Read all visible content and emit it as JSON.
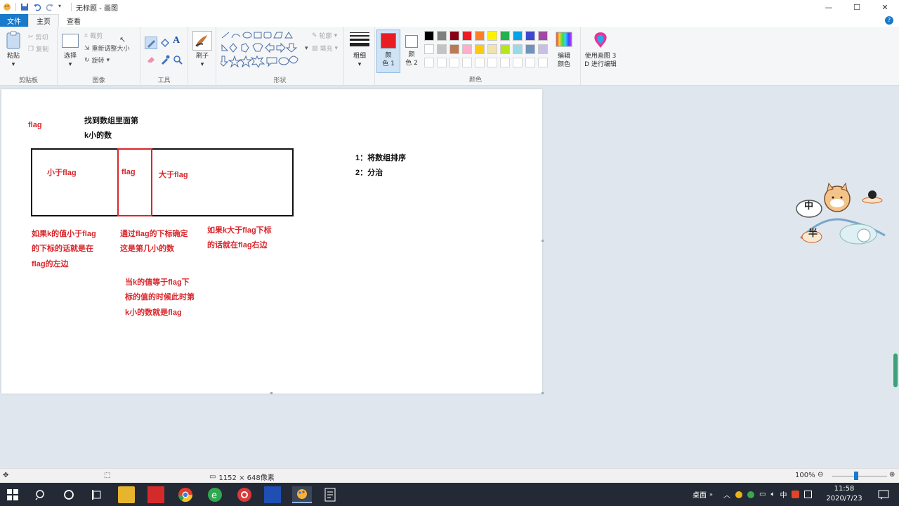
{
  "window": {
    "title": "无标题 - 画图",
    "controls": [
      "—",
      "☐",
      "✕"
    ]
  },
  "tabs": [
    {
      "label": "文件"
    },
    {
      "label": "主页"
    },
    {
      "label": "查看"
    }
  ],
  "ribbon": {
    "clipboard": {
      "paste": "粘贴",
      "cut": "剪切",
      "copy": "复制",
      "label": "剪贴板"
    },
    "image": {
      "select": "选择",
      "crop": "裁剪",
      "resize": "重新调整大小",
      "rotate": "旋转",
      "label": "图像"
    },
    "tools": {
      "label": "工具"
    },
    "brushes": {
      "label": "刷子"
    },
    "shapes": {
      "outline": "轮廓",
      "fill": "填充",
      "label": "形状"
    },
    "size": {
      "label": "粗细"
    },
    "color1": {
      "label_line1": "颜",
      "label_line2": "色 1",
      "color": "#e81c23"
    },
    "color2": {
      "label_line1": "颜",
      "label_line2": "色 2",
      "color": "#ffffff"
    },
    "palette": {
      "row1": [
        "#000000",
        "#7f7f7f",
        "#880015",
        "#ed1c24",
        "#ff7f27",
        "#fff200",
        "#22b14c",
        "#00a2e8",
        "#3f48cc",
        "#a349a4"
      ],
      "row2": [
        "#ffffff",
        "#c3c3c3",
        "#b97a57",
        "#ffaec9",
        "#ffc90e",
        "#efe4b0",
        "#b5e61d",
        "#99d9ea",
        "#7092be",
        "#c8bfe7"
      ]
    },
    "edit_colors": {
      "line1": "编辑",
      "line2": "颜色"
    },
    "paint3d": {
      "line1": "使用画图 3",
      "line2": "D 进行编辑"
    },
    "colors_label": "颜色"
  },
  "canvas": {
    "flag_left": "flag",
    "title_line1": "找到数组里面第",
    "title_line2": "k小的数",
    "less_flag": "小于flag",
    "flag_mid": "flag",
    "greater_flag": "大于flag",
    "note_left": [
      "如果k的值小于flag",
      "的下标的话就是在",
      "flag的左边"
    ],
    "note_mid": [
      "通过flag的下标确定",
      "这是第几小的数"
    ],
    "note_right": [
      "如果k大于flag下标",
      "的话就在flag右边"
    ],
    "note_bottom": [
      "当k的值等于flag下",
      "标的值的时候此时第",
      "k小的数就是flag"
    ],
    "steps": [
      "1：将数组排序",
      "2：分治"
    ]
  },
  "sticker": {
    "char1": "中",
    "char2": "半"
  },
  "status": {
    "dimensions": "1152 × 648像素",
    "zoom": "100%"
  },
  "taskbar": {
    "desktop_label": "桌面",
    "ime": "中",
    "time": "11:58",
    "date": "2020/7/23"
  }
}
